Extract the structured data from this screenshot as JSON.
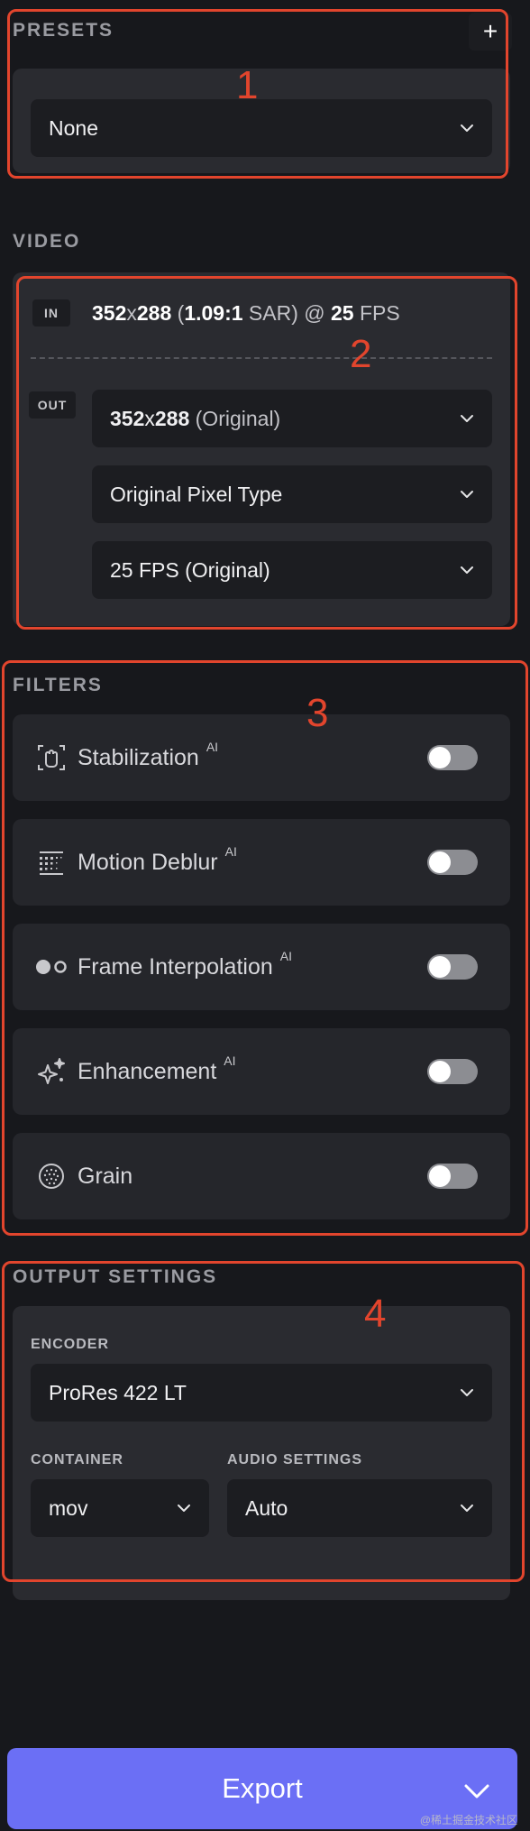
{
  "presets": {
    "title": "PRESETS",
    "add_label": "+",
    "selected": "None"
  },
  "video": {
    "title": "VIDEO",
    "in_badge": "IN",
    "out_badge": "OUT",
    "input": {
      "width": "352",
      "x": "x",
      "height": "288",
      "sar_open": "(",
      "sar_value": "1.09:1",
      "sar_close": " SAR) @ ",
      "fps": "25",
      "fps_unit": " FPS"
    },
    "output_resolution": {
      "width": "352",
      "x": "x",
      "height": "288",
      "suffix": " (Original)"
    },
    "pixel_type": "Original Pixel Type",
    "frame_rate": "25 FPS (Original)"
  },
  "filters": {
    "title": "FILTERS",
    "items": [
      {
        "name": "Stabilization",
        "ai": "AI",
        "icon": "stabilization-icon",
        "enabled": false
      },
      {
        "name": "Motion Deblur",
        "ai": "AI",
        "icon": "motion-deblur-icon",
        "enabled": false
      },
      {
        "name": "Frame Interpolation",
        "ai": "AI",
        "icon": "frame-interpolation-icon",
        "enabled": false
      },
      {
        "name": "Enhancement",
        "ai": "AI",
        "icon": "enhancement-icon",
        "enabled": false
      },
      {
        "name": "Grain",
        "ai": "",
        "icon": "grain-icon",
        "enabled": false
      }
    ]
  },
  "output_settings": {
    "title": "OUTPUT SETTINGS",
    "encoder_label": "ENCODER",
    "encoder": "ProRes 422 LT",
    "container_label": "CONTAINER",
    "container": "mov",
    "audio_label": "AUDIO SETTINGS",
    "audio": "Auto"
  },
  "annotations": [
    "1",
    "2",
    "3",
    "4"
  ],
  "export_label": "Export",
  "watermark": "@稀土掘金技术社区",
  "colors": {
    "background": "#17181c",
    "panel": "#2a2b30",
    "accent": "#6b6ff5",
    "annotation": "#e2452d"
  }
}
